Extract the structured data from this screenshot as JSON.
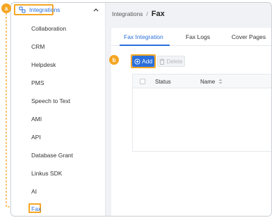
{
  "sidebar": {
    "group_label": "Integrations",
    "items": [
      {
        "label": "Collaboration"
      },
      {
        "label": "CRM"
      },
      {
        "label": "Helpdesk"
      },
      {
        "label": "PMS"
      },
      {
        "label": "Speech to Text"
      },
      {
        "label": "AMI"
      },
      {
        "label": "API"
      },
      {
        "label": "Database Grant"
      },
      {
        "label": "Linkus SDK"
      },
      {
        "label": "AI"
      },
      {
        "label": "Fax"
      }
    ]
  },
  "breadcrumb": {
    "parent": "Integrations",
    "separator": "/",
    "current": "Fax"
  },
  "tabs": [
    {
      "label": "Fax Integration"
    },
    {
      "label": "Fax Logs"
    },
    {
      "label": "Cover Pages"
    }
  ],
  "toolbar": {
    "add_label": "Add",
    "delete_label": "Delete"
  },
  "table": {
    "columns": [
      "Status",
      "Name"
    ]
  },
  "annotations": {
    "a": "a",
    "b": "b"
  },
  "colors": {
    "accent": "#2a6fdb",
    "highlight": "#f5a623"
  }
}
